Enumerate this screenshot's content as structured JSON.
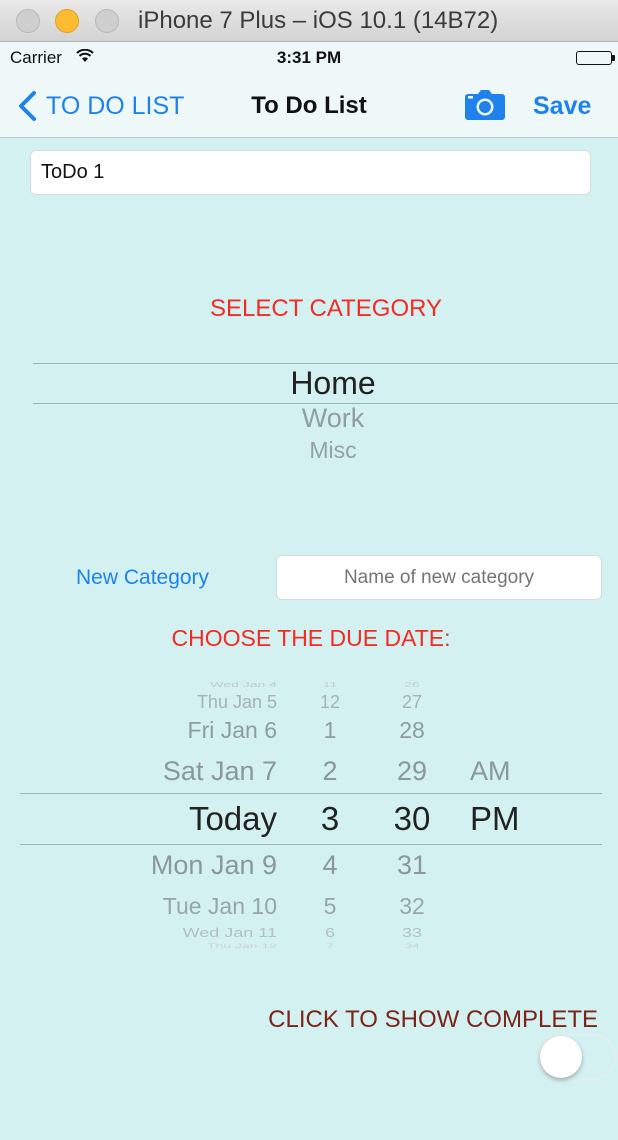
{
  "window": {
    "title": "iPhone 7 Plus – iOS 10.1 (14B72)"
  },
  "status_bar": {
    "carrier": "Carrier",
    "time": "3:31 PM"
  },
  "nav": {
    "back_label": "TO DO LIST",
    "title": "To Do List",
    "save_label": "Save"
  },
  "todo_name": {
    "value": "ToDo 1"
  },
  "category": {
    "heading": "SELECT CATEGORY",
    "options": [
      "Home",
      "Work",
      "Misc"
    ],
    "selected": "Home"
  },
  "new_category": {
    "button_label": "New Category",
    "placeholder": "Name of new category"
  },
  "due_date": {
    "heading": "CHOOSE THE DUE DATE:",
    "days": [
      "Wed Jan 4",
      "Thu Jan 5",
      "Fri Jan 6",
      "Sat Jan 7",
      "Today",
      "Mon Jan 9",
      "Tue Jan 10",
      "Wed Jan 11",
      "Thu Jan 12"
    ],
    "hours": [
      "11",
      "12",
      "1",
      "2",
      "3",
      "4",
      "5",
      "6",
      "7"
    ],
    "minutes": [
      "26",
      "27",
      "28",
      "29",
      "30",
      "31",
      "32",
      "33",
      "34"
    ],
    "ampm": [
      "AM",
      "PM"
    ],
    "selected": {
      "day": "Today",
      "hour": "3",
      "minute": "30",
      "ampm": "PM"
    }
  },
  "complete": {
    "label": "CLICK TO SHOW COMPLETE",
    "toggle_on": false
  },
  "colors": {
    "background": "#d4f1f2",
    "tint": "#1f82ec",
    "heading_red": "#f42a24",
    "complete_label": "#7b2418"
  }
}
